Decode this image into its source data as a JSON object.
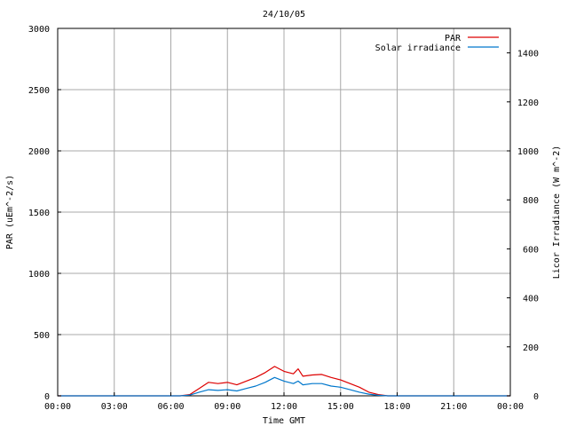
{
  "chart_data": {
    "type": "line",
    "title": "24/10/05",
    "xlabel": "Time GMT",
    "ylabel": "PAR (uEm^-2/s)",
    "y2label": "Licor Irradiance (W m^-2)",
    "xlim": [
      0,
      24
    ],
    "ylim": [
      0,
      3000
    ],
    "y2lim": [
      0,
      1500
    ],
    "x_ticks": [
      0,
      3,
      6,
      9,
      12,
      15,
      18,
      21,
      24
    ],
    "x_tick_labels": [
      "00:00",
      "03:00",
      "06:00",
      "09:00",
      "12:00",
      "15:00",
      "18:00",
      "21:00",
      "00:00"
    ],
    "y_ticks": [
      0,
      500,
      1000,
      1500,
      2000,
      2500,
      3000
    ],
    "y_tick_labels": [
      "0",
      "500",
      "1000",
      "1500",
      "2000",
      "2500",
      "3000"
    ],
    "y2_ticks": [
      0,
      200,
      400,
      600,
      800,
      1000,
      1200,
      1400
    ],
    "y2_tick_labels": [
      "0",
      "200",
      "400",
      "600",
      "800",
      "1000",
      "1200",
      "1400"
    ],
    "grid": true,
    "legend_position": "top-right",
    "series": [
      {
        "name": "PAR",
        "color": "#dd0000",
        "axis": "left",
        "x": [
          0,
          6.5,
          7.0,
          7.5,
          8.0,
          8.5,
          9.0,
          9.5,
          10.0,
          10.5,
          11.0,
          11.5,
          12.0,
          12.5,
          12.75,
          13.0,
          13.5,
          14.0,
          14.5,
          15.0,
          15.5,
          16.0,
          16.5,
          17.0,
          17.5,
          24
        ],
        "y": [
          0,
          0,
          10,
          60,
          110,
          100,
          110,
          90,
          120,
          150,
          190,
          240,
          200,
          180,
          220,
          160,
          170,
          175,
          150,
          130,
          100,
          70,
          30,
          10,
          0,
          0
        ]
      },
      {
        "name": "Solar irradiance",
        "color": "#0077cc",
        "axis": "right",
        "x": [
          0,
          6.5,
          7.0,
          7.5,
          8.0,
          8.5,
          9.0,
          9.5,
          10.0,
          10.5,
          11.0,
          11.5,
          12.0,
          12.5,
          12.75,
          13.0,
          13.5,
          14.0,
          14.5,
          15.0,
          15.5,
          16.0,
          16.5,
          17.0,
          17.5,
          24
        ],
        "y": [
          0,
          0,
          3,
          15,
          25,
          22,
          25,
          20,
          30,
          40,
          55,
          75,
          60,
          50,
          60,
          45,
          50,
          50,
          40,
          35,
          25,
          15,
          7,
          2,
          0,
          0
        ]
      }
    ]
  }
}
